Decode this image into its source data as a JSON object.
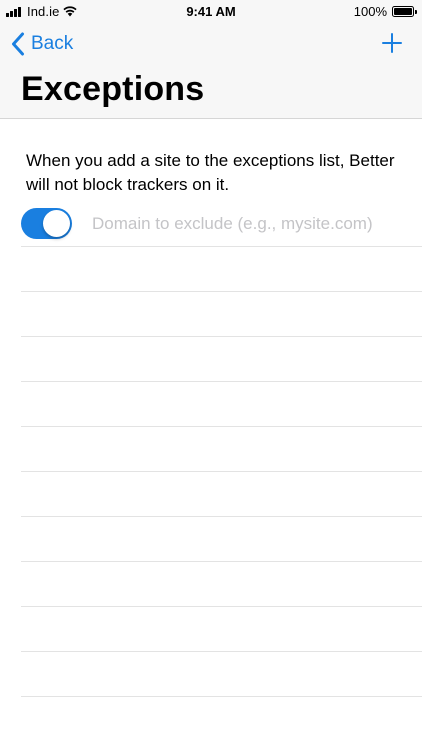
{
  "status_bar": {
    "carrier": "Ind.ie",
    "time": "9:41 AM",
    "battery": "100%",
    "battery_level": 1.0,
    "icons": [
      "signal-icon",
      "wifi-icon",
      "battery-icon"
    ]
  },
  "nav": {
    "back_label": "Back",
    "back_icon": "chevron-left-icon",
    "add_icon": "plus-icon",
    "title": "Exceptions"
  },
  "content": {
    "description": "When you add a site to the exceptions list, Better will not block trackers on it.",
    "toggle_on": true,
    "domain_value": "",
    "domain_placeholder": "Domain to exclude (e.g., mysite.com)"
  },
  "colors": {
    "accent": "#1a7fe0",
    "header_bg": "#f7f7f7",
    "placeholder": "#c4c4c7",
    "separator": "#e3e3e3"
  }
}
